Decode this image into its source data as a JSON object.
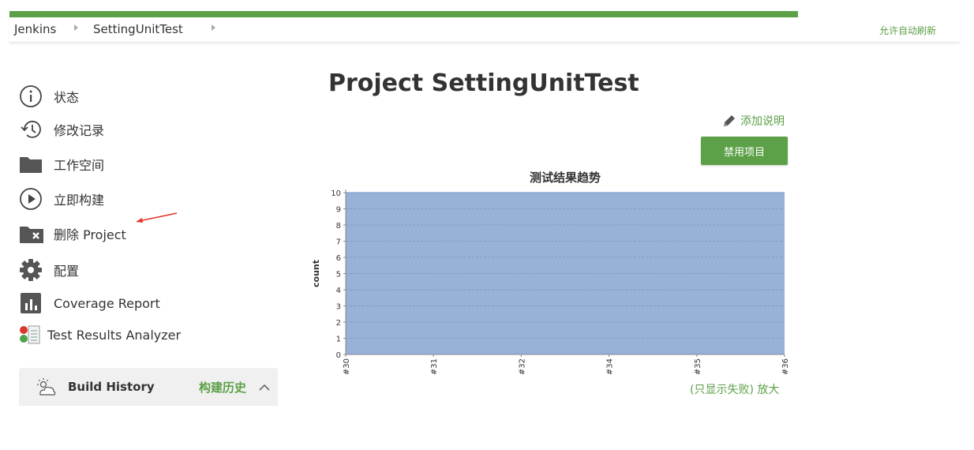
{
  "top_progress": 0.83,
  "breadcrumb": {
    "items": [
      "Jenkins",
      "SettingUnitTest"
    ]
  },
  "auto_refresh_label": "允许自动刷新",
  "sidebar": {
    "items": [
      {
        "label": "状态",
        "icon": "info-icon"
      },
      {
        "label": "修改记录",
        "icon": "history-icon"
      },
      {
        "label": "工作空间",
        "icon": "folder-icon"
      },
      {
        "label": "立即构建",
        "icon": "play-icon"
      },
      {
        "label": "删除 Project",
        "icon": "delete-folder-icon"
      },
      {
        "label": "配置",
        "icon": "gear-icon"
      },
      {
        "label": "Coverage Report",
        "icon": "bar-chart-icon"
      },
      {
        "label": "Test Results Analyzer",
        "icon": "test-results-icon"
      }
    ]
  },
  "build_history": {
    "title": "Build History",
    "link": "构建历史",
    "icon": "weather-icon"
  },
  "project_title": "Project SettingUnitTest",
  "add_description_label": "添加说明",
  "disable_button_label": "禁用项目",
  "zoom_links": "(只显示失败) 放大",
  "colors": {
    "accent": "#5ca047",
    "chart_fill": "#97b1d8",
    "chart_line": "#7f9fcf",
    "annotation_arrow": "#e8332a"
  },
  "chart_data": {
    "type": "area",
    "title": "测试结果趋势",
    "xlabel": "",
    "ylabel": "count",
    "categories": [
      "#30",
      "#31",
      "#32",
      "#34",
      "#35",
      "#36"
    ],
    "series": [
      {
        "values": [
          10,
          10,
          10,
          10,
          10,
          10
        ]
      }
    ],
    "ylim": [
      0,
      10
    ],
    "yticks": [
      0,
      1,
      2,
      3,
      4,
      5,
      6,
      7,
      8,
      9,
      10
    ],
    "grid": true
  }
}
